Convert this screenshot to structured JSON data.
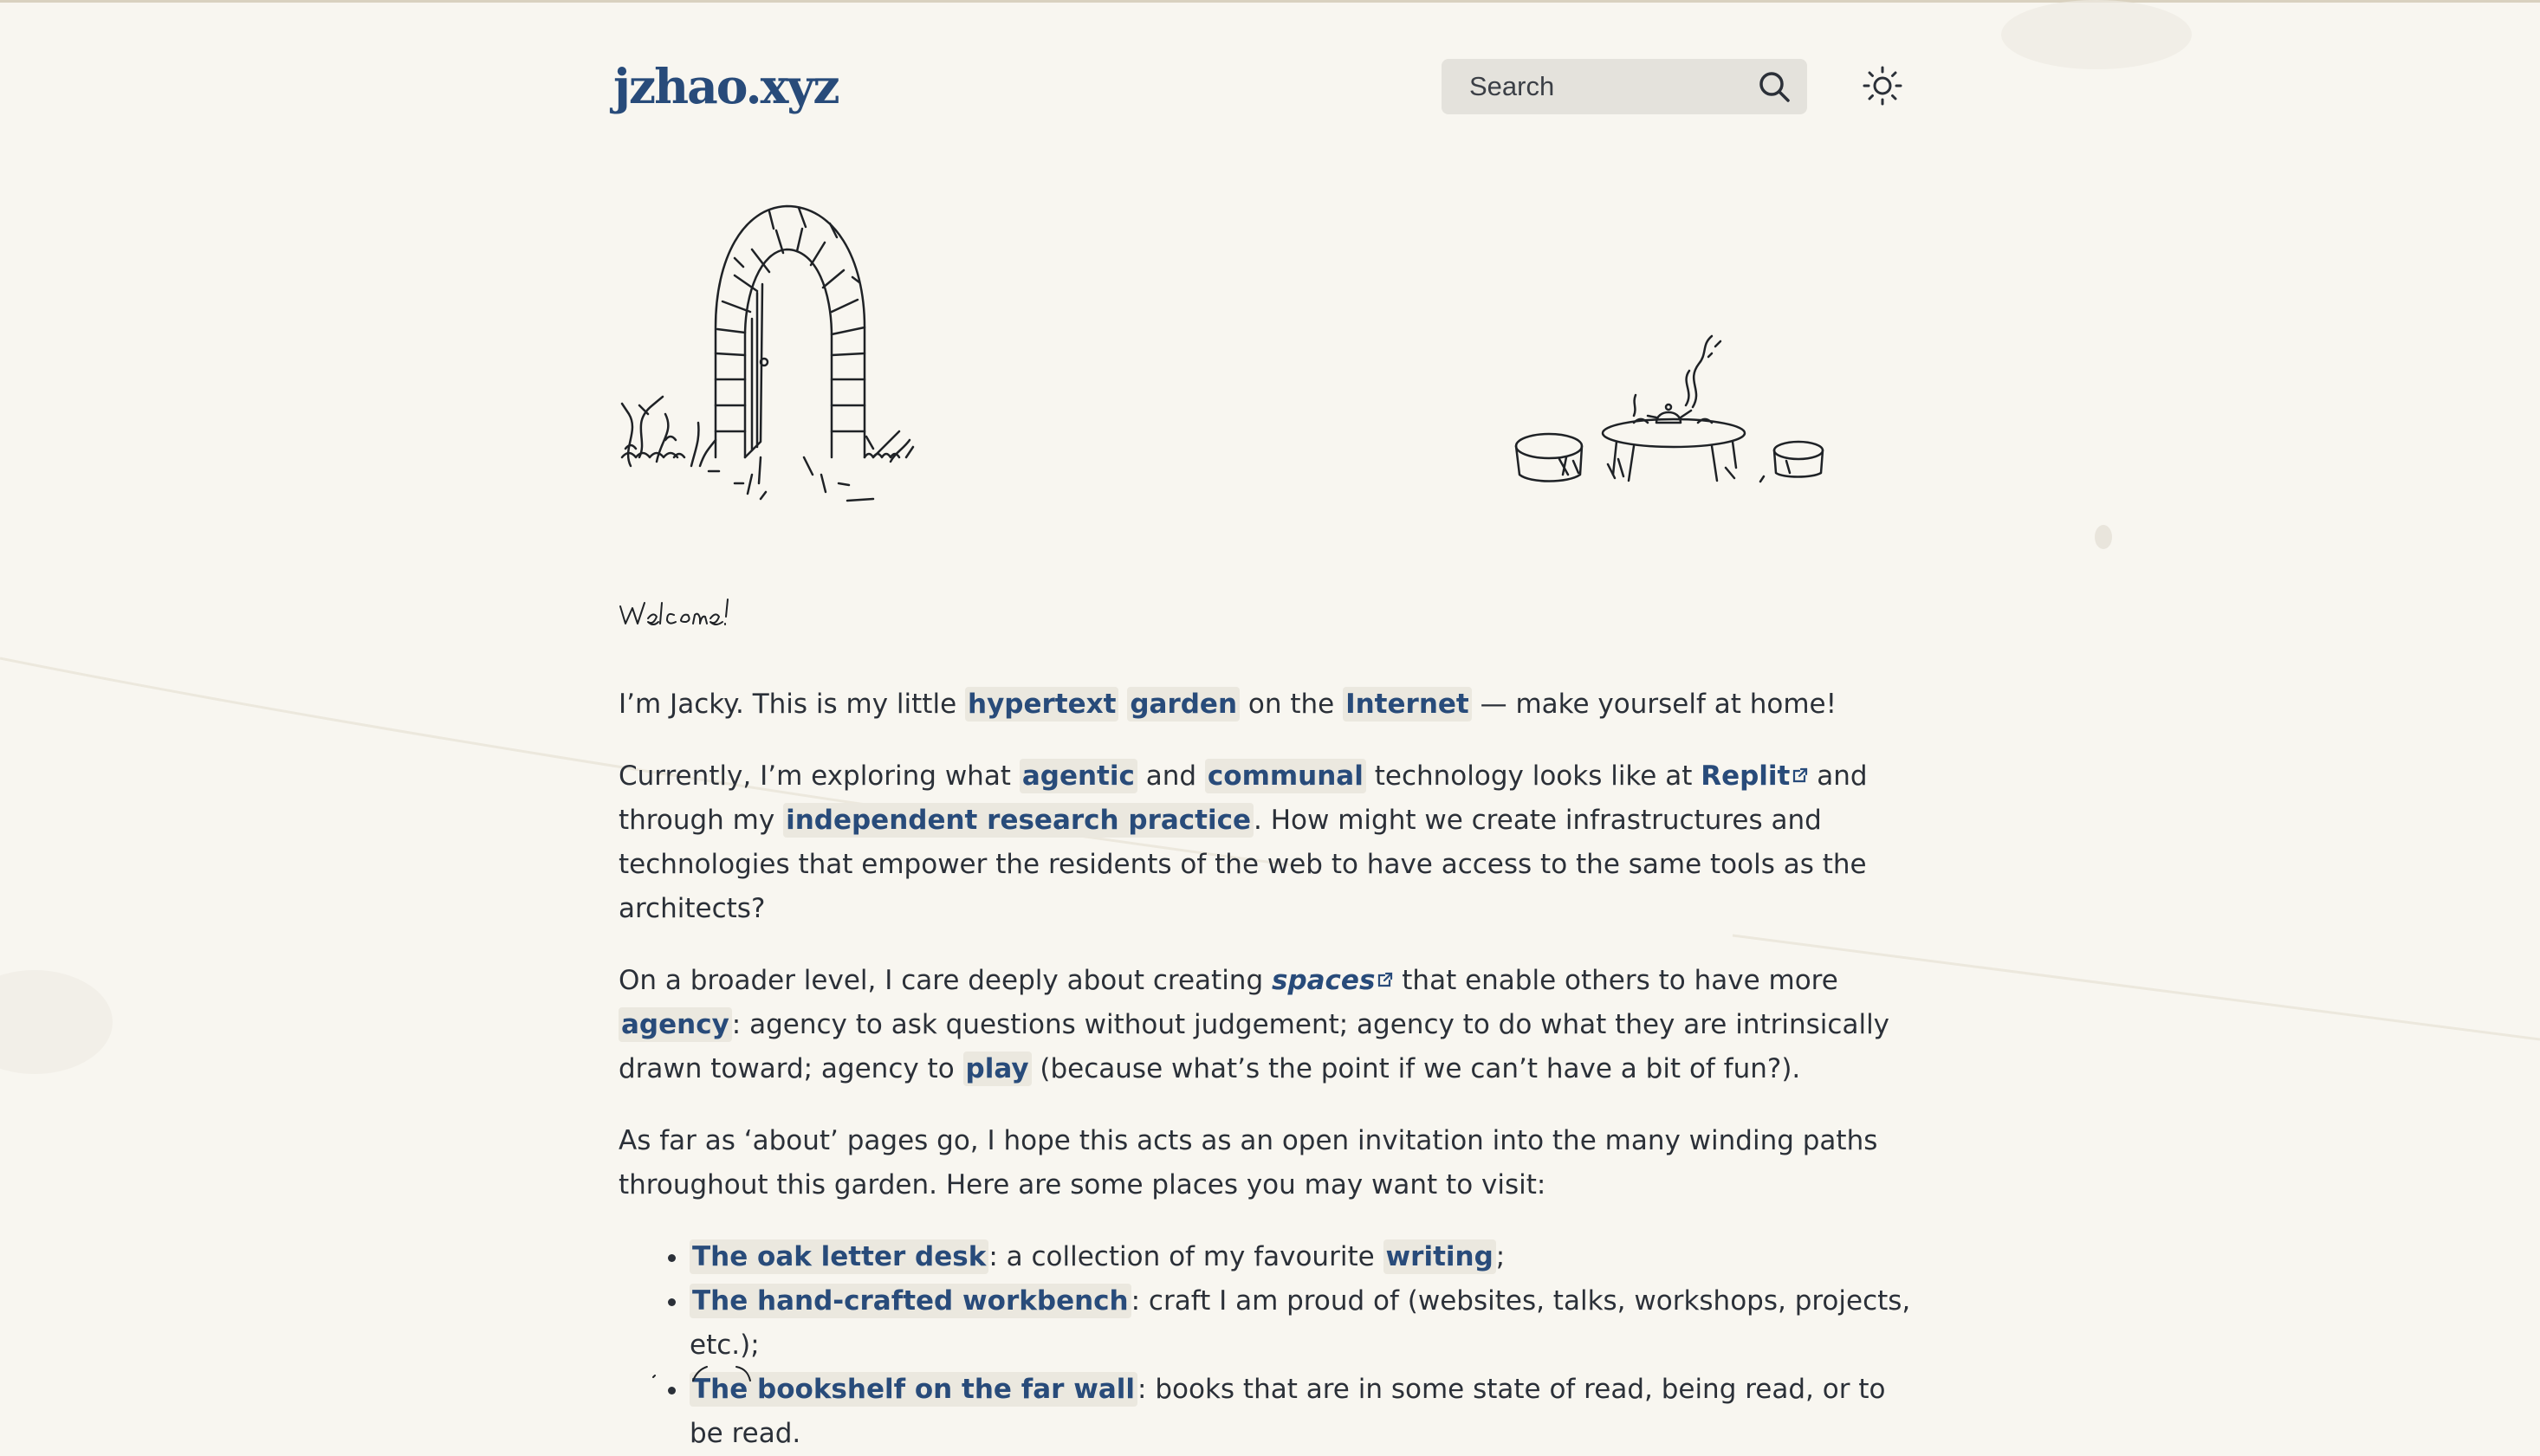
{
  "header": {
    "site_title": "jzhao.xyz",
    "search": {
      "placeholder": "Search"
    }
  },
  "welcome_text": "Welcome!",
  "intro": {
    "lead": "I’m Jacky. This is my little ",
    "link_hypertext": "hypertext",
    "link_garden": "garden",
    "mid": " on the ",
    "link_internet": "Internet",
    "tail": " — make yourself at home!"
  },
  "currently": {
    "lead": "Currently, I’m exploring what ",
    "link_agentic": "agentic",
    "and": " and ",
    "link_communal": "communal",
    "mid": " technology looks like at ",
    "link_replit": "Replit",
    "mid2": " and through my ",
    "link_research": "independent research practice",
    "tail": ". How might we create infrastructures and technologies that em­power the residents of the web to have access to the same tools as the architects?"
  },
  "broader": {
    "lead": "On a broader level, I care deeply about creating ",
    "link_spaces": "spaces",
    "mid": " that enable others to have more ",
    "link_agency": "agency",
    "mid2": ": agency to ask questions without judgement; agency to do what they are intrinsically drawn toward; agency to ",
    "link_play": "play",
    "tail": " (because what’s the point if we can’t have a bit of fun?)."
  },
  "about": {
    "text": "As far as ‘about’ pages go, I hope this acts as an open invitation into the many winding paths throughout this garden. Here are some places you may want to visit:"
  },
  "places": [
    {
      "link": "The oak letter desk",
      "desc_lead": ": a collection of my favourite ",
      "desc_link": "writing",
      "desc_tail": ";"
    },
    {
      "link": "The hand-crafted workbench",
      "desc_lead": ": craft I am proud of (websites, talks, workshops, projects, etc.);",
      "desc_link": "",
      "desc_tail": ""
    },
    {
      "link": "The bookshelf on the far wall",
      "desc_lead": ": books that are in some state of read, being read, or to be read.",
      "desc_link": "",
      "desc_tail": ""
    }
  ],
  "colors": {
    "background": "#f8f6f0",
    "link": "#284b7a",
    "link_bg": "#ebe8df",
    "text": "#2b3038",
    "search_bg": "#e4e2dc"
  },
  "icons": {
    "search": "search-icon",
    "theme": "sun-icon",
    "external": "external-link-icon"
  }
}
